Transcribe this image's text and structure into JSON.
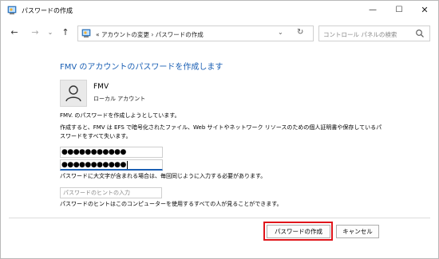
{
  "window": {
    "title": "パスワードの作成",
    "minimize_glyph": "—",
    "maximize_glyph": "☐",
    "close_glyph": "✕"
  },
  "nav": {
    "back_glyph": "←",
    "forward_glyph": "→",
    "recent_glyph": "⌄",
    "up_glyph": "↑",
    "breadcrumb": "« アカウントの変更 › パスワードの作成",
    "dropdown_glyph": "⌄",
    "refresh_glyph": "↻",
    "search_placeholder": "コントロール パネルの検索"
  },
  "main": {
    "heading": "FMV のアカウントのパスワードを作成します",
    "account": {
      "name": "FMV",
      "type": "ローカル アカウント"
    },
    "intro": "FMV. のパスワードを作成しようとしています。",
    "warning": "作成すると、FMV は EFS で暗号化されたファイル、Web サイトやネットワーク リソースのための個人証明書や保存しているパスワードをすべて失います。",
    "password_mask": "●●●●●●●●●●●",
    "confirm_mask": "●●●●●●●●●●●",
    "case_note": "パスワードに大文字が含まれる場合は、毎回同じように入力する必要があります。",
    "hint_placeholder": "パスワードのヒントの入力",
    "hint_note": "パスワードのヒントはこのコンピューターを使用するすべての人が見ることができます。"
  },
  "footer": {
    "create_label": "パスワードの作成",
    "cancel_label": "キャンセル"
  },
  "colors": {
    "heading": "#1a5fb4",
    "highlight": "#e0151b",
    "focus": "#1a5fb4"
  },
  "icons": {
    "app": "control-panel-icon",
    "user": "user-icon",
    "search": "search-icon"
  }
}
